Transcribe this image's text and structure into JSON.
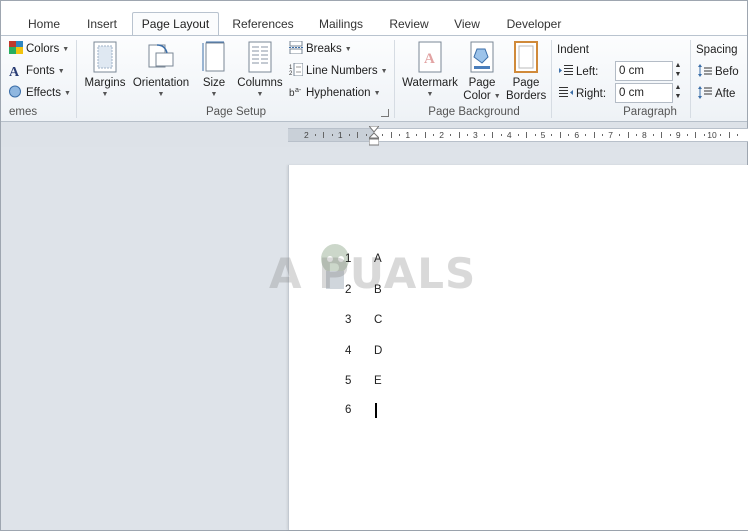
{
  "tabs": [
    {
      "label": "Home",
      "active": false
    },
    {
      "label": "Insert",
      "active": false
    },
    {
      "label": "Page Layout",
      "active": true
    },
    {
      "label": "References",
      "active": false
    },
    {
      "label": "Mailings",
      "active": false
    },
    {
      "label": "Review",
      "active": false
    },
    {
      "label": "View",
      "active": false
    },
    {
      "label": "Developer",
      "active": false
    }
  ],
  "themes": {
    "colors": "Colors",
    "fonts": "Fonts",
    "effects": "Effects",
    "group_label": "emes"
  },
  "page_setup": {
    "margins": "Margins",
    "orientation": "Orientation",
    "size": "Size",
    "columns": "Columns",
    "breaks": "Breaks",
    "line_numbers": "Line Numbers",
    "hyphenation": "Hyphenation",
    "group_label": "Page Setup"
  },
  "page_background": {
    "watermark": "Watermark",
    "page_color_1": "Page",
    "page_color_2": "Color",
    "page_borders_1": "Page",
    "page_borders_2": "Borders",
    "group_label": "Page Background"
  },
  "paragraph": {
    "indent_title": "Indent",
    "left_label": "Left:",
    "left_value": "0 cm",
    "right_label": "Right:",
    "right_value": "0 cm",
    "spacing_title": "Spacing",
    "before_label": "Befo",
    "after_label": "Afte",
    "group_label": "Paragraph"
  },
  "ruler": {
    "left_labels": [
      "2",
      "1"
    ],
    "right_labels": [
      "1",
      "2",
      "3",
      "4",
      "5",
      "6",
      "7",
      "8",
      "9",
      "10"
    ]
  },
  "watermark_text": "A  PUALS",
  "document": {
    "lines": [
      {
        "num": "1",
        "text": "A"
      },
      {
        "num": "2",
        "text": "B"
      },
      {
        "num": "3",
        "text": "C"
      },
      {
        "num": "4",
        "text": "D"
      },
      {
        "num": "5",
        "text": "E"
      },
      {
        "num": "6",
        "text": ""
      }
    ]
  },
  "colors": {
    "accent": "#2b579a",
    "ribbon_border": "#b9c3cf",
    "workspace": "#dee3e9"
  }
}
